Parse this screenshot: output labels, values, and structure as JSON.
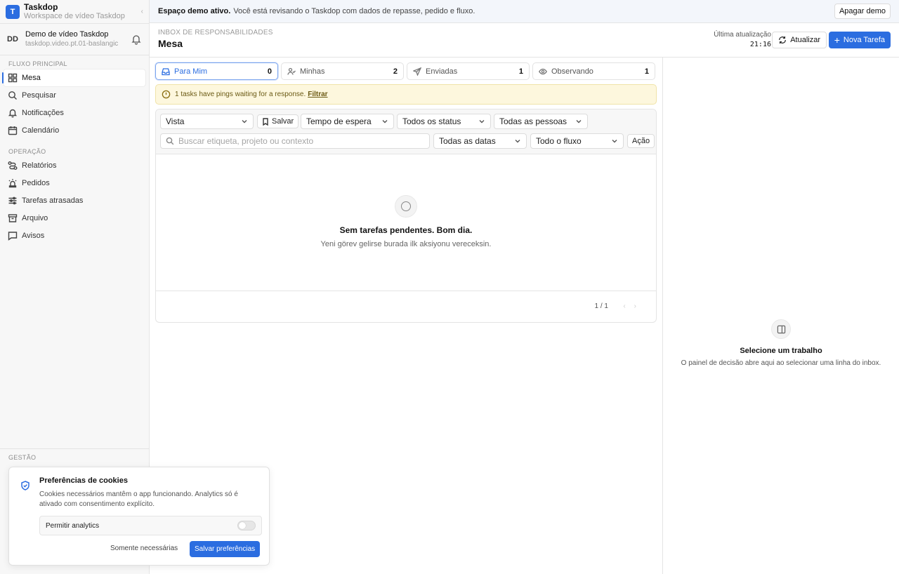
{
  "colors": {
    "accent": "#2b6de0",
    "alert_bg": "#fdf7dd",
    "banner_bg": "#f3f6fb"
  },
  "sidebar": {
    "brand": {
      "logo": "T",
      "name": "Taskdop",
      "sub": "Workspace de vídeo Taskdop"
    },
    "user": {
      "initials": "DD",
      "name": "Demo de vídeo Taskdop",
      "sub": "taskdop.video.pt.01-baslangic"
    },
    "section_main": "FLUXO PRINCIPAL",
    "main_items": [
      {
        "label": "Mesa",
        "icon": "grid-icon"
      },
      {
        "label": "Pesquisar",
        "icon": "search-icon"
      },
      {
        "label": "Notificações",
        "icon": "bell-icon"
      },
      {
        "label": "Calendário",
        "icon": "calendar-icon"
      }
    ],
    "section_ops": "OPERAÇÃO",
    "ops_items": [
      {
        "label": "Relatórios",
        "icon": "route-icon"
      },
      {
        "label": "Pedidos",
        "icon": "alarm-icon"
      },
      {
        "label": "Tarefas atrasadas",
        "icon": "sliders-icon"
      },
      {
        "label": "Arquivo",
        "icon": "archive-icon"
      },
      {
        "label": "Avisos",
        "icon": "message-icon"
      }
    ],
    "section_mgmt": "GESTÃO"
  },
  "banner": {
    "strong": "Espaço demo ativo.",
    "text": "Você está revisando o Taskdop com dados de repasse, pedido e fluxo.",
    "button": "Apagar demo"
  },
  "header": {
    "breadcrumb": "INBOX DE RESPONSABILIDADES",
    "title": "Mesa",
    "updated_label": "Última atualização",
    "updated_time": "21:16",
    "refresh": "Atualizar",
    "new_task": "Nova Tarefa"
  },
  "tabs": [
    {
      "label": "Para Mim",
      "count": "0",
      "icon": "inbox-icon"
    },
    {
      "label": "Minhas",
      "count": "2",
      "icon": "user-check-icon"
    },
    {
      "label": "Enviadas",
      "count": "1",
      "icon": "send-icon"
    },
    {
      "label": "Observando",
      "count": "1",
      "icon": "eye-icon"
    }
  ],
  "alert": {
    "text": "1 tasks have pings waiting for a response.",
    "link": "Filtrar"
  },
  "filters": {
    "view": "Vista",
    "save": "Salvar",
    "wait": "Tempo de espera",
    "status": "Todos os status",
    "people": "Todas as pessoas",
    "search_placeholder": "Buscar etiqueta, projeto ou contexto",
    "dates": "Todas as datas",
    "flow": "Todo o fluxo",
    "action": "Ação"
  },
  "empty": {
    "title": "Sem tarefas pendentes. Bom dia.",
    "sub": "Yeni görev gelirse burada ilk aksiyonu vereceksin."
  },
  "pager": {
    "text": "1 / 1"
  },
  "detail": {
    "title": "Selecione um trabalho",
    "sub": "O painel de decisão abre aqui ao selecionar uma linha do inbox."
  },
  "cookie": {
    "title": "Preferências de cookies",
    "text": "Cookies necessários mantêm o app funcionando. Analytics só é ativado com consentimento explícito.",
    "toggle_label": "Permitir analytics",
    "toggle_on": false,
    "secondary": "Somente necessárias",
    "primary": "Salvar preferências"
  }
}
